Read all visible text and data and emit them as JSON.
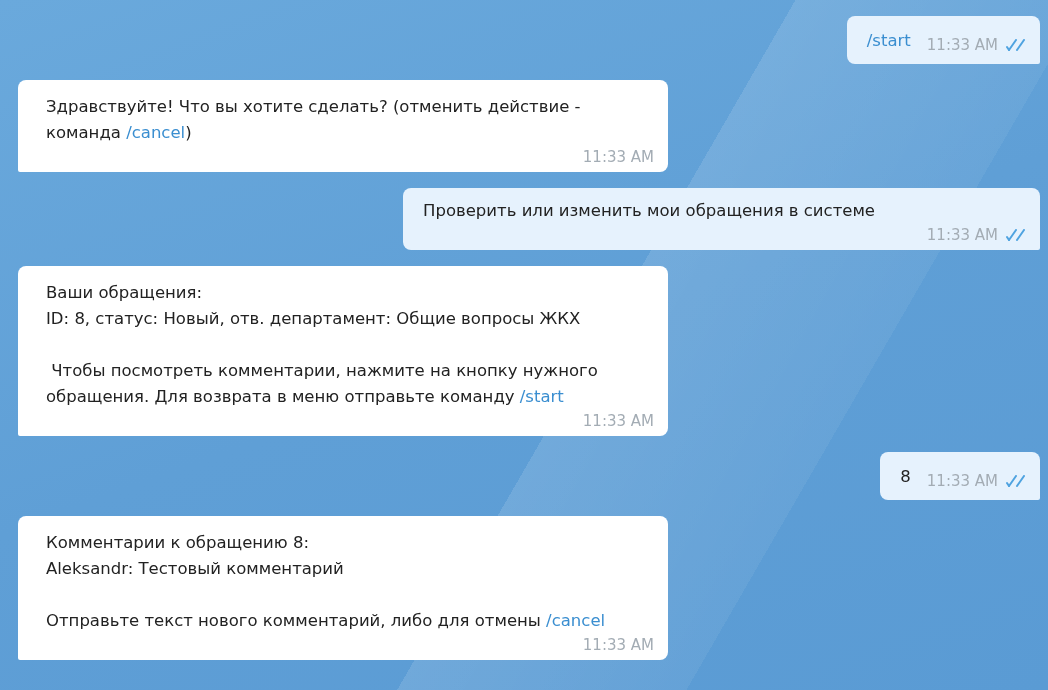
{
  "messages": [
    {
      "outgoing": true,
      "kind": "inline",
      "time": "11:33 AM",
      "read": true,
      "paragraphs": [
        [
          [
            {
              "kind": "link",
              "text": "/start"
            }
          ]
        ]
      ]
    },
    {
      "outgoing": false,
      "kind": "block",
      "time": "11:33 AM",
      "paragraphs": [
        [
          [
            {
              "kind": "text",
              "text": "Здравствуйте! Что вы хотите сделать? (отменить действие -"
            }
          ],
          [
            {
              "kind": "text",
              "text": "команда "
            },
            {
              "kind": "link",
              "text": "/cancel"
            },
            {
              "kind": "text",
              "text": ")"
            }
          ]
        ]
      ]
    },
    {
      "outgoing": true,
      "kind": "block",
      "time": "11:33 AM",
      "read": true,
      "paragraphs": [
        [
          [
            {
              "kind": "text",
              "text": "Проверить или изменить мои обращения в системе"
            }
          ]
        ]
      ]
    },
    {
      "outgoing": false,
      "kind": "block",
      "time": "11:33 AM",
      "paragraphs": [
        [
          [
            {
              "kind": "text",
              "text": "Ваши обращения:"
            }
          ],
          [
            {
              "kind": "text",
              "text": "ID: 8, статус: Новый, отв. департамент: Общие вопросы ЖКХ"
            }
          ]
        ],
        [
          [
            {
              "kind": "text",
              "text": " Чтобы посмотреть комментарии, нажмите на кнопку нужного"
            }
          ],
          [
            {
              "kind": "text",
              "text": "обращения. Для возврата в меню отправьте команду "
            },
            {
              "kind": "link",
              "text": "/start"
            }
          ]
        ]
      ]
    },
    {
      "outgoing": true,
      "kind": "inline",
      "time": "11:33 AM",
      "read": true,
      "paragraphs": [
        [
          [
            {
              "kind": "text",
              "text": "8"
            }
          ]
        ]
      ]
    },
    {
      "outgoing": false,
      "kind": "block",
      "time": "11:33 AM",
      "paragraphs": [
        [
          [
            {
              "kind": "text",
              "text": "Комментарии к обращению 8:"
            }
          ],
          [
            {
              "kind": "text",
              "text": "Aleksandr: Тестовый комментарий"
            }
          ]
        ],
        [
          [
            {
              "kind": "text",
              "text": "Отправьте текст нового комментарий, либо для отмены "
            },
            {
              "kind": "link",
              "text": "/cancel"
            }
          ]
        ]
      ]
    }
  ]
}
